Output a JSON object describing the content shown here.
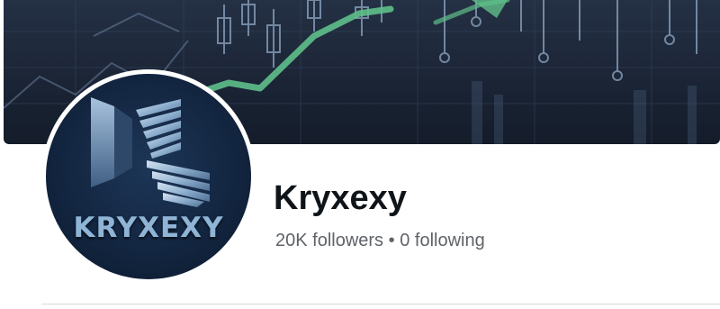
{
  "profile": {
    "name": "Kryxexy",
    "followers": "20K followers",
    "separator": "•",
    "following": "0 following",
    "avatar_text": "KRYXEXY"
  },
  "cover": {
    "description_icon": "stock-chart-banner",
    "accent_color": "#5fbf8a"
  },
  "colors": {
    "name": "#0f1419",
    "stats": "#5f6368",
    "divider": "#d9d9d9"
  }
}
